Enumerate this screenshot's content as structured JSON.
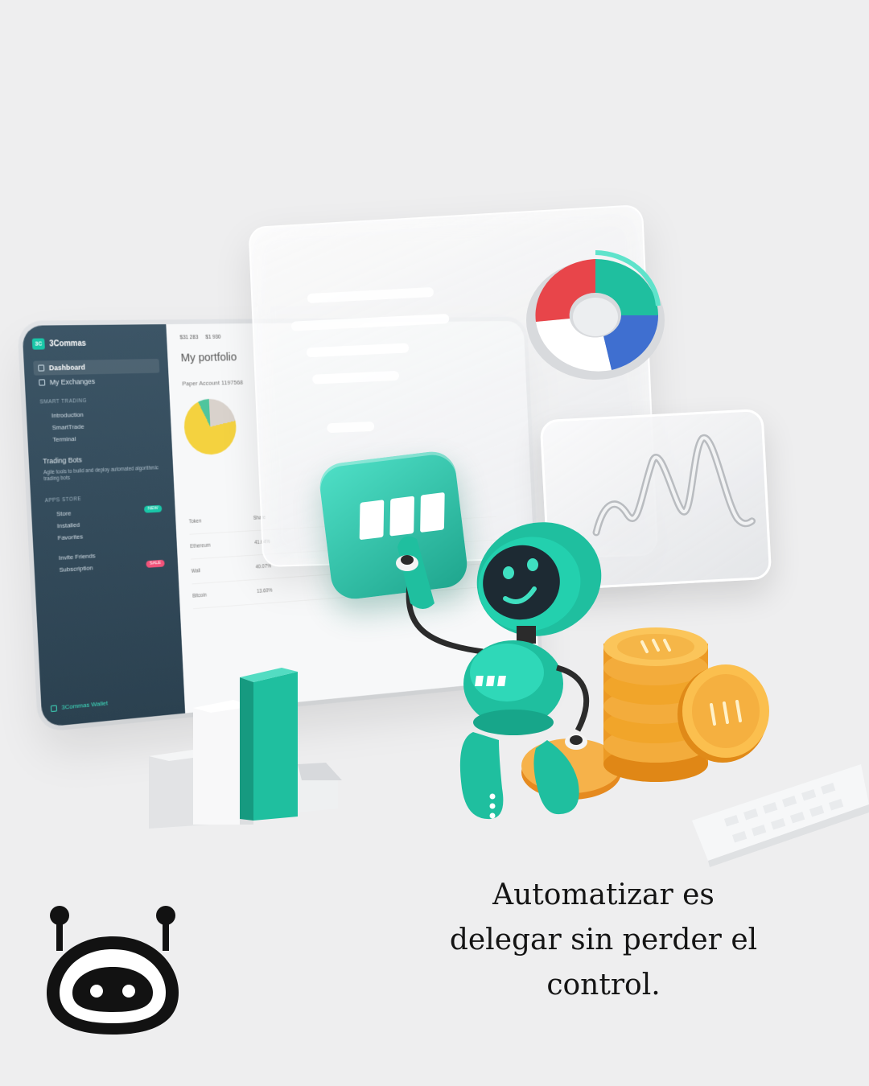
{
  "caption": {
    "line1": "Automatizar es",
    "line2": "delegar sin perder el",
    "line3": "control."
  },
  "dashboard": {
    "brand": "3Commas",
    "brand_mark": "3C",
    "balances": [
      "$31 283",
      "$1 930"
    ],
    "title": "My portfolio",
    "paper_account": "Paper Account 1197568",
    "nav": {
      "dashboard": "Dashboard",
      "my_exchanges": "My Exchanges",
      "smart_trading_section": "SMART TRADING",
      "introduction": "Introduction",
      "smarttrade": "SmartTrade",
      "terminal": "Terminal",
      "trading_bots": "Trading Bots",
      "trading_bots_desc": "Agile tools to build and deploy automated algorithmic trading bots",
      "apps_store_section": "APPS STORE",
      "store": "Store",
      "store_badge": "NEW",
      "installed": "Installed",
      "favorites": "Favorites",
      "invite_friends": "Invite Friends",
      "subscription": "Subscription",
      "subscription_badge": "SALE",
      "wallet": "3Commas Wallet"
    },
    "table": {
      "header": [
        "Token",
        "Share"
      ],
      "rows": [
        [
          "Ethereum",
          "41.64%"
        ],
        [
          "Wall",
          "40.07%"
        ],
        [
          "Bitcoin",
          "13.60%"
        ]
      ]
    }
  },
  "colors": {
    "teal": "#1fbf9f",
    "donut_red": "#e8454a",
    "donut_blue": "#3f6fd0",
    "coin_gold": "#f1a52a",
    "sidebar_bg": "#34495a",
    "background": "#eeeeef"
  },
  "icons": [
    "robot-logo-icon",
    "donut-chart-icon",
    "line-chart-icon",
    "coin-stack-icon",
    "robot-mascot-icon",
    "bar-blocks-icon",
    "keyboard-icon"
  ]
}
